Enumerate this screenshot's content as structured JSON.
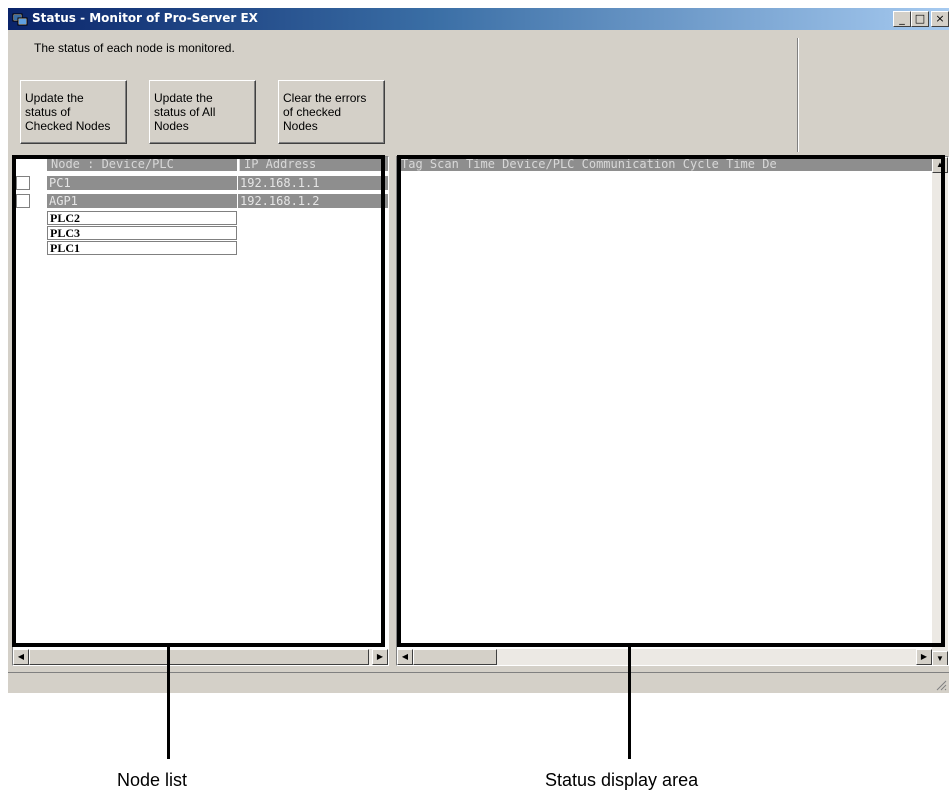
{
  "window": {
    "title": "Status - Monitor of Pro-Server EX",
    "controls": {
      "minimize": "_",
      "maximize": "□",
      "close": "×"
    },
    "accent_color": "#0a246a"
  },
  "description": "The status of each node is monitored.",
  "buttons": {
    "update_checked": "Update the\nstatus of\nChecked Nodes",
    "update_all": "Update the\nstatus of All\nNodes",
    "clear_errors": "Clear the errors\nof checked\nNodes"
  },
  "node_list": {
    "columns": [
      "Node : Device/PLC",
      "IP Address"
    ],
    "rows": [
      {
        "name": "PC1",
        "ip": "192.168.1.1",
        "selected": true
      },
      {
        "name": "AGP1",
        "ip": "192.168.1.2",
        "selected": true
      },
      {
        "name": "PLC2",
        "ip": "",
        "selected": false
      },
      {
        "name": "PLC3",
        "ip": "",
        "selected": false
      },
      {
        "name": "PLC1",
        "ip": "",
        "selected": false
      }
    ]
  },
  "status_area": {
    "header": "Tag Scan Time  Device/PLC Communication Cycle Time  De"
  },
  "scroll_icons": {
    "left": "◀",
    "right": "▶",
    "up": "▲",
    "down": "▼"
  },
  "callouts": {
    "node_list": "Node list",
    "status_area": "Status display area"
  }
}
